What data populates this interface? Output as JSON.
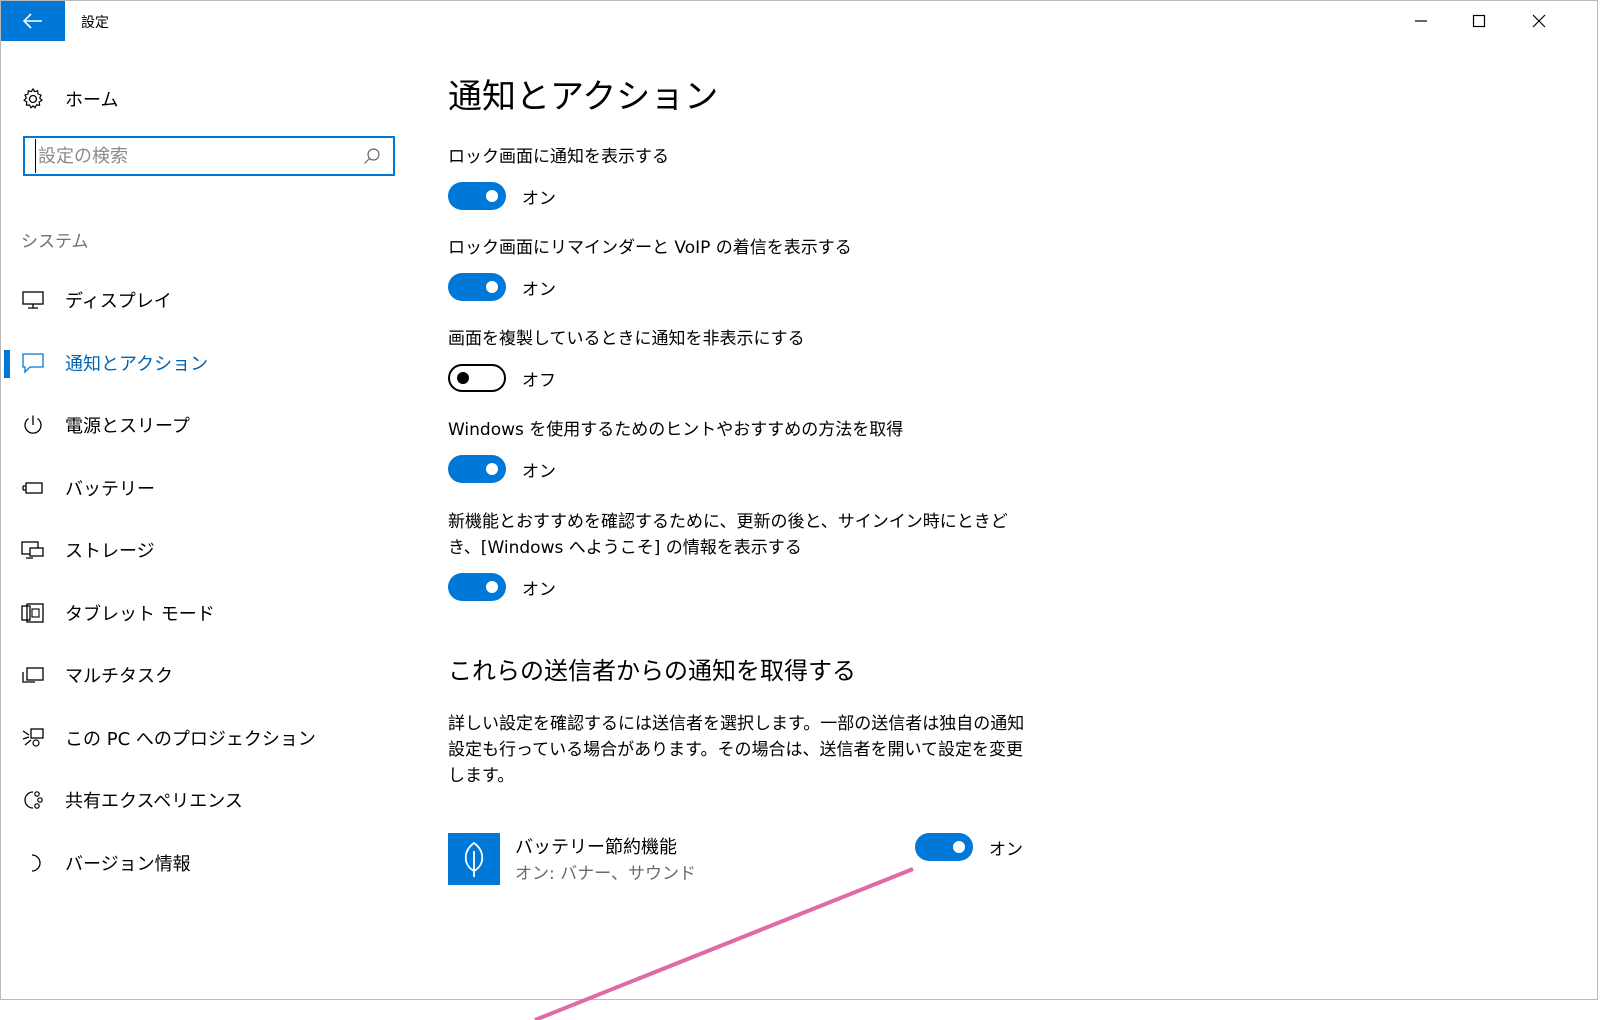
{
  "titlebar": {
    "app_title": "設定",
    "back_icon": "back-arrow-icon",
    "controls": [
      "minimize-icon",
      "maximize-icon",
      "close-icon"
    ]
  },
  "sidebar": {
    "home_label": "ホーム",
    "home_icon": "gear-icon",
    "search_placeholder": "設定の検索",
    "search_value": "",
    "section_title": "システム",
    "items": [
      {
        "label": "ディスプレイ",
        "icon": "monitor-icon",
        "selected": false
      },
      {
        "label": "通知とアクション",
        "icon": "message-icon",
        "selected": true
      },
      {
        "label": "電源とスリープ",
        "icon": "power-icon",
        "selected": false
      },
      {
        "label": "バッテリー",
        "icon": "battery-icon",
        "selected": false
      },
      {
        "label": "ストレージ",
        "icon": "storage-icon",
        "selected": false
      },
      {
        "label": "タブレット モード",
        "icon": "tablet-icon",
        "selected": false
      },
      {
        "label": "マルチタスク",
        "icon": "multitask-icon",
        "selected": false
      },
      {
        "label": "この PC へのプロジェクション",
        "icon": "projection-icon",
        "selected": false
      },
      {
        "label": "共有エクスペリエンス",
        "icon": "shared-icon",
        "selected": false
      },
      {
        "label": "バージョン情報",
        "icon": "info-icon",
        "selected": false
      }
    ]
  },
  "main": {
    "page_title": "通知とアクション",
    "settings": [
      {
        "desc": "ロック画面に通知を表示する",
        "state": "on",
        "state_label": "オン"
      },
      {
        "desc": "ロック画面にリマインダーと VoIP の着信を表示する",
        "state": "on",
        "state_label": "オン"
      },
      {
        "desc": "画面を複製しているときに通知を非表示にする",
        "state": "off",
        "state_label": "オフ"
      },
      {
        "desc": "Windows を使用するためのヒントやおすすめの方法を取得",
        "state": "on",
        "state_label": "オン"
      },
      {
        "desc": "新機能とおすすめを確認するために、更新の後と、サインイン時にときどき、[Windows へようこそ] の情報を表示する",
        "state": "on",
        "state_label": "オン"
      }
    ],
    "senders_title": "これらの送信者からの通知を取得する",
    "senders_info": "詳しい設定を確認するには送信者を選択します。一部の送信者は独自の通知設定も行っている場合があります。その場合は、送信者を開いて設定を変更します。",
    "senders": [
      {
        "name": "バッテリー節約機能",
        "status": "オン: バナー、サウンド",
        "icon": "leaf-icon",
        "state": "on",
        "state_label": "オン"
      }
    ]
  },
  "colors": {
    "accent": "#0078d7",
    "annotation": "#e06aa8"
  }
}
